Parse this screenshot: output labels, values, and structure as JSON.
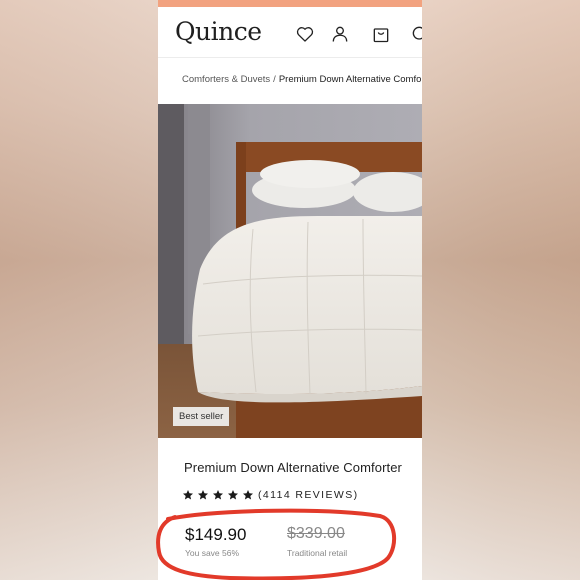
{
  "brand": {
    "logo": "Quince"
  },
  "header": {
    "icons": [
      "heart-icon",
      "user-icon",
      "cart-icon",
      "search-icon"
    ]
  },
  "breadcrumb": {
    "parent": "Comforters & Duvets",
    "separator": "/",
    "current": "Premium Down Alternative Comforter"
  },
  "hero": {
    "badge": "Best seller"
  },
  "product": {
    "title": "Premium Down Alternative Comforter",
    "rating": 5,
    "reviews": "(4114 REVIEWS)",
    "price": "$149.90",
    "savings": "You save 56%",
    "retail_price": "$339.00",
    "retail_label": "Traditional retail"
  },
  "colors": {
    "promo_bar": "#f2a27f",
    "annotation": "#e23a2a",
    "text": "#222222"
  }
}
